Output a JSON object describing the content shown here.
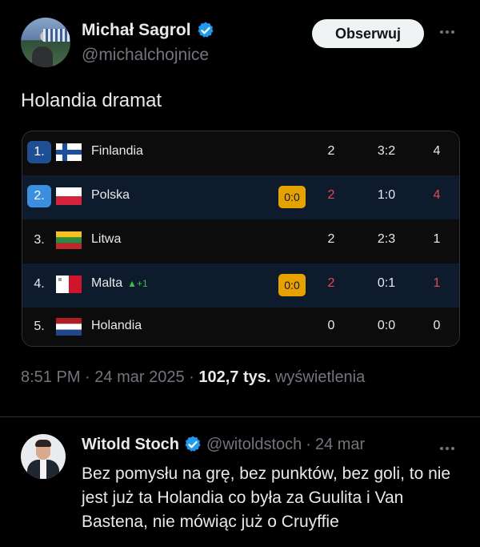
{
  "tweet": {
    "display_name": "Michał Sagrol",
    "handle": "@michalchojnice",
    "follow_label": "Obserwuj",
    "text": "Holandia dramat",
    "time": "8:51 PM",
    "date": "24 mar 2025",
    "views_count": "102,7 tys.",
    "views_label": "wyświetlenia"
  },
  "standings": {
    "rows": [
      {
        "position": "1.",
        "team": "Finlandia",
        "live": "",
        "matches": "2",
        "goals": "3:2",
        "points": "4",
        "flag": "finland-flag",
        "highlight": "dark"
      },
      {
        "position": "2.",
        "team": "Polska",
        "live": "0:0",
        "matches": "2",
        "goals": "1:0",
        "points": "4",
        "flag": "poland-flag",
        "highlight": "blue"
      },
      {
        "position": "3.",
        "team": "Litwa",
        "live": "",
        "matches": "2",
        "goals": "2:3",
        "points": "1",
        "flag": "lithuania-flag",
        "highlight": "dark"
      },
      {
        "position": "4.",
        "team": "Malta",
        "trend": "▲+1",
        "live": "0:0",
        "matches": "2",
        "goals": "0:1",
        "points": "1",
        "flag": "malta-flag",
        "highlight": "blue"
      },
      {
        "position": "5.",
        "team": "Holandia",
        "live": "",
        "matches": "0",
        "goals": "0:0",
        "points": "0",
        "flag": "netherlands-flag",
        "highlight": "dark"
      }
    ]
  },
  "reply": {
    "display_name": "Witold Stoch",
    "handle": "@witoldstoch",
    "separator": "·",
    "date": "24 mar",
    "text": "Bez pomysłu na grę, bez punktów, bez goli, to nie jest już ta Holandia co była za Guulita i Van Bastena, nie mówiąc już o Cruyffie"
  },
  "colors": {
    "accent_blue": "#1d9bf0",
    "live_badge": "#e6a300",
    "loss_red": "#e5484d",
    "trend_green": "#3fb950"
  }
}
